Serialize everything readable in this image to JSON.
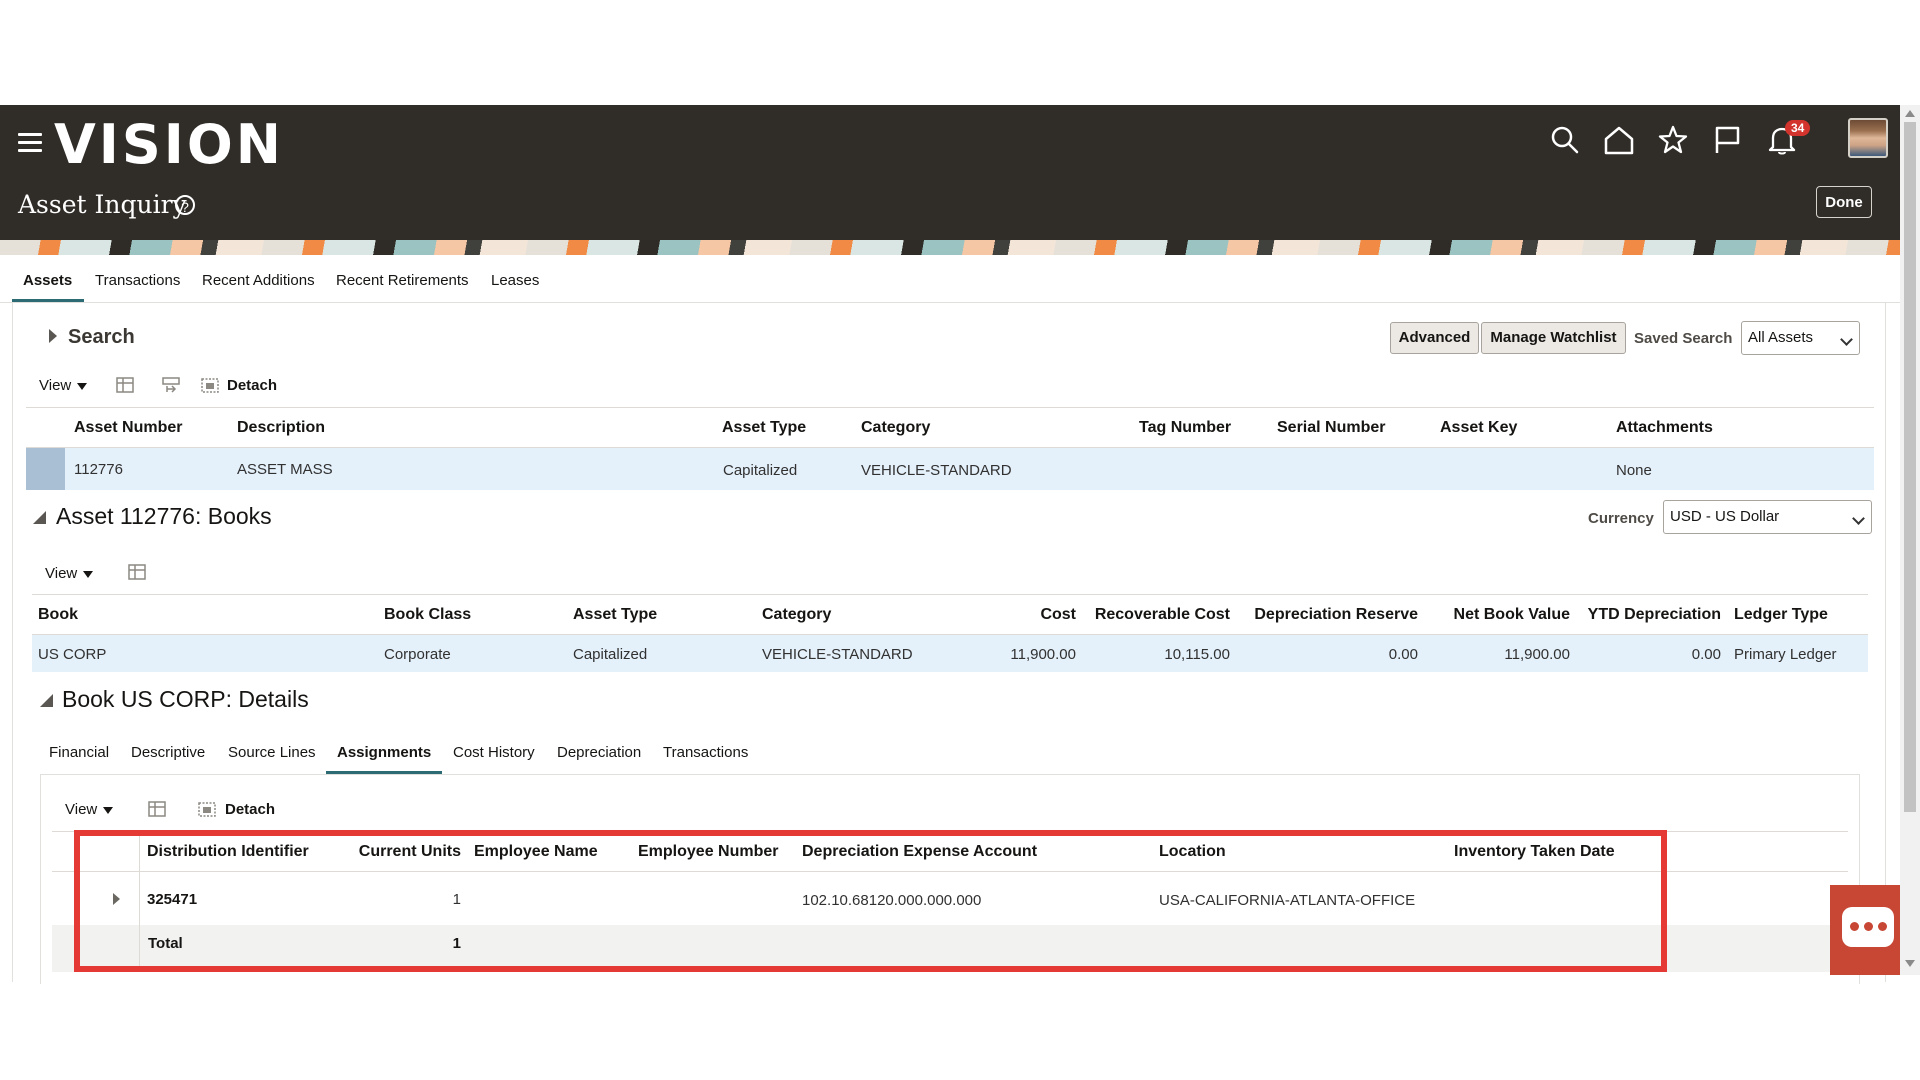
{
  "header": {
    "logo": "VISION",
    "page_title": "Asset Inquiry",
    "help_symbol": "?",
    "notification_count": "34",
    "done_label": "Done",
    "icons": [
      "hamburger-menu-icon",
      "search-icon",
      "home-icon",
      "star-icon",
      "flag-icon",
      "bell-icon",
      "avatar"
    ]
  },
  "tabs": [
    {
      "label": "Assets",
      "active": true
    },
    {
      "label": "Transactions",
      "active": false
    },
    {
      "label": "Recent Additions",
      "active": false
    },
    {
      "label": "Recent Retirements",
      "active": false
    },
    {
      "label": "Leases",
      "active": false
    }
  ],
  "search": {
    "title": "Search",
    "advanced_label": "Advanced",
    "watchlist_label": "Manage Watchlist",
    "saved_search_label": "Saved Search",
    "saved_search_value": "All Assets"
  },
  "toolbar": {
    "view_label": "View",
    "detach_label": "Detach"
  },
  "assets_table": {
    "columns": [
      "Asset Number",
      "Description",
      "Asset Type",
      "Category",
      "Tag Number",
      "Serial Number",
      "Asset Key",
      "Attachments"
    ],
    "rows": [
      {
        "asset_number": "112776",
        "description": "ASSET MASS",
        "asset_type": "Capitalized",
        "category": "VEHICLE-STANDARD",
        "tag_number": "",
        "serial_number": "",
        "asset_key": "",
        "attachments": "None"
      }
    ]
  },
  "books_section": {
    "title": "Asset 112776: Books",
    "currency_label": "Currency",
    "currency_value": "USD - US Dollar",
    "columns": [
      "Book",
      "Book Class",
      "Asset Type",
      "Category",
      "Cost",
      "Recoverable Cost",
      "Depreciation Reserve",
      "Net Book Value",
      "YTD Depreciation",
      "Ledger Type"
    ],
    "rows": [
      {
        "book": "US CORP",
        "book_class": "Corporate",
        "asset_type": "Capitalized",
        "category": "VEHICLE-STANDARD",
        "cost": "11,900.00",
        "recoverable_cost": "10,115.00",
        "depreciation_reserve": "0.00",
        "net_book_value": "11,900.00",
        "ytd_depreciation": "0.00",
        "ledger_type": "Primary Ledger"
      }
    ]
  },
  "details_section": {
    "title": "Book US CORP: Details",
    "tabs": [
      {
        "label": "Financial",
        "active": false
      },
      {
        "label": "Descriptive",
        "active": false
      },
      {
        "label": "Source Lines",
        "active": false
      },
      {
        "label": "Assignments",
        "active": true
      },
      {
        "label": "Cost History",
        "active": false
      },
      {
        "label": "Depreciation",
        "active": false
      },
      {
        "label": "Transactions",
        "active": false
      }
    ]
  },
  "assignments_table": {
    "columns": [
      "Distribution Identifier",
      "Current Units",
      "Employee Name",
      "Employee Number",
      "Depreciation Expense Account",
      "Location",
      "Inventory Taken Date"
    ],
    "rows": [
      {
        "distribution_identifier": "325471",
        "current_units": "1",
        "employee_name": "",
        "employee_number": "",
        "depreciation_expense_account": "102.10.68120.000.000.000",
        "location": "USA-CALIFORNIA-ATLANTA-OFFICE",
        "inventory_taken_date": ""
      }
    ],
    "total_label": "Total",
    "total_units": "1"
  },
  "colors": {
    "header_bg": "#302c28",
    "selected_row": "#e4f0fa",
    "highlight_box": "#e53935",
    "chat_widget": "#c74634",
    "notification_badge": "#d2342d"
  }
}
